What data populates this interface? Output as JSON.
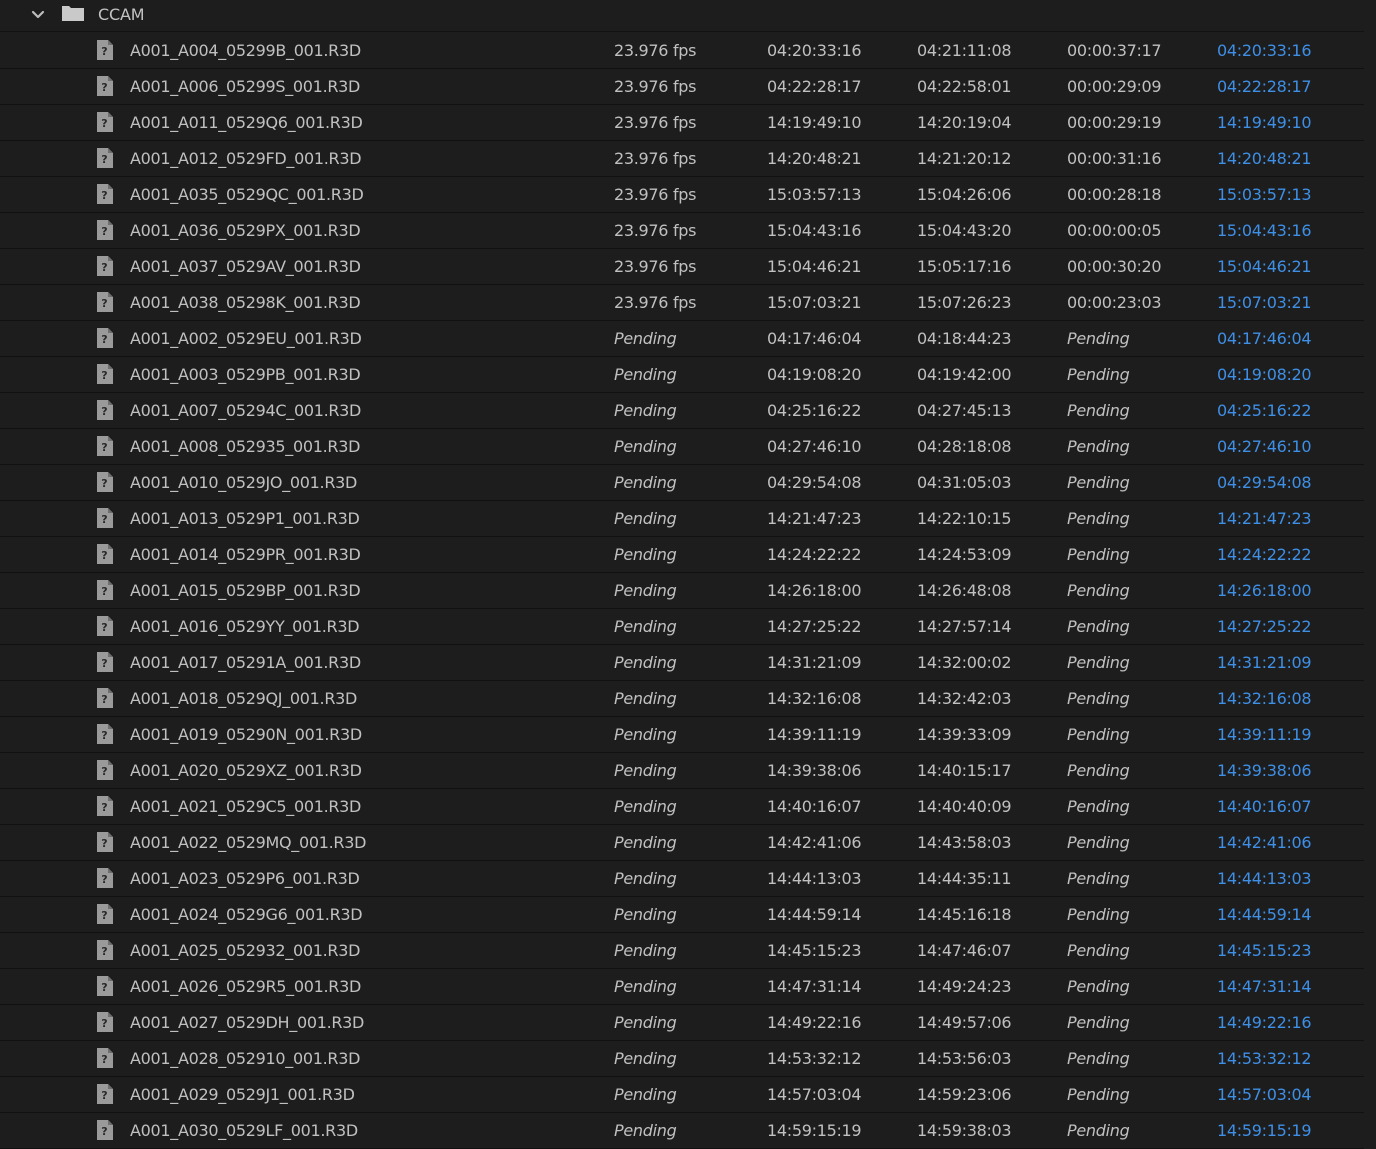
{
  "folder": {
    "name": "CCAM"
  },
  "colors": {
    "background": "#1d1d1d",
    "text": "#c0c0c0",
    "timecode_link": "#3e8fe6",
    "row_divider": "#111111"
  },
  "icons": {
    "expand": "chevron-down-icon",
    "folder": "folder-icon",
    "clip": "missing-file-icon"
  },
  "clips": [
    {
      "name": "A001_A004_05299B_001.R3D",
      "fps": "23.976 fps",
      "media_start": "04:20:33:16",
      "media_end": "04:21:11:08",
      "duration": "00:00:37:17",
      "timecode": "04:20:33:16"
    },
    {
      "name": "A001_A006_05299S_001.R3D",
      "fps": "23.976 fps",
      "media_start": "04:22:28:17",
      "media_end": "04:22:58:01",
      "duration": "00:00:29:09",
      "timecode": "04:22:28:17"
    },
    {
      "name": "A001_A011_0529Q6_001.R3D",
      "fps": "23.976 fps",
      "media_start": "14:19:49:10",
      "media_end": "14:20:19:04",
      "duration": "00:00:29:19",
      "timecode": "14:19:49:10"
    },
    {
      "name": "A001_A012_0529FD_001.R3D",
      "fps": "23.976 fps",
      "media_start": "14:20:48:21",
      "media_end": "14:21:20:12",
      "duration": "00:00:31:16",
      "timecode": "14:20:48:21"
    },
    {
      "name": "A001_A035_0529QC_001.R3D",
      "fps": "23.976 fps",
      "media_start": "15:03:57:13",
      "media_end": "15:04:26:06",
      "duration": "00:00:28:18",
      "timecode": "15:03:57:13"
    },
    {
      "name": "A001_A036_0529PX_001.R3D",
      "fps": "23.976 fps",
      "media_start": "15:04:43:16",
      "media_end": "15:04:43:20",
      "duration": "00:00:00:05",
      "timecode": "15:04:43:16"
    },
    {
      "name": "A001_A037_0529AV_001.R3D",
      "fps": "23.976 fps",
      "media_start": "15:04:46:21",
      "media_end": "15:05:17:16",
      "duration": "00:00:30:20",
      "timecode": "15:04:46:21"
    },
    {
      "name": "A001_A038_05298K_001.R3D",
      "fps": "23.976 fps",
      "media_start": "15:07:03:21",
      "media_end": "15:07:26:23",
      "duration": "00:00:23:03",
      "timecode": "15:07:03:21"
    },
    {
      "name": "A001_A002_0529EU_001.R3D",
      "fps": "Pending",
      "media_start": "04:17:46:04",
      "media_end": "04:18:44:23",
      "duration": "Pending",
      "timecode": "04:17:46:04"
    },
    {
      "name": "A001_A003_0529PB_001.R3D",
      "fps": "Pending",
      "media_start": "04:19:08:20",
      "media_end": "04:19:42:00",
      "duration": "Pending",
      "timecode": "04:19:08:20"
    },
    {
      "name": "A001_A007_05294C_001.R3D",
      "fps": "Pending",
      "media_start": "04:25:16:22",
      "media_end": "04:27:45:13",
      "duration": "Pending",
      "timecode": "04:25:16:22"
    },
    {
      "name": "A001_A008_052935_001.R3D",
      "fps": "Pending",
      "media_start": "04:27:46:10",
      "media_end": "04:28:18:08",
      "duration": "Pending",
      "timecode": "04:27:46:10"
    },
    {
      "name": "A001_A010_0529JO_001.R3D",
      "fps": "Pending",
      "media_start": "04:29:54:08",
      "media_end": "04:31:05:03",
      "duration": "Pending",
      "timecode": "04:29:54:08"
    },
    {
      "name": "A001_A013_0529P1_001.R3D",
      "fps": "Pending",
      "media_start": "14:21:47:23",
      "media_end": "14:22:10:15",
      "duration": "Pending",
      "timecode": "14:21:47:23"
    },
    {
      "name": "A001_A014_0529PR_001.R3D",
      "fps": "Pending",
      "media_start": "14:24:22:22",
      "media_end": "14:24:53:09",
      "duration": "Pending",
      "timecode": "14:24:22:22"
    },
    {
      "name": "A001_A015_0529BP_001.R3D",
      "fps": "Pending",
      "media_start": "14:26:18:00",
      "media_end": "14:26:48:08",
      "duration": "Pending",
      "timecode": "14:26:18:00"
    },
    {
      "name": "A001_A016_0529YY_001.R3D",
      "fps": "Pending",
      "media_start": "14:27:25:22",
      "media_end": "14:27:57:14",
      "duration": "Pending",
      "timecode": "14:27:25:22"
    },
    {
      "name": "A001_A017_05291A_001.R3D",
      "fps": "Pending",
      "media_start": "14:31:21:09",
      "media_end": "14:32:00:02",
      "duration": "Pending",
      "timecode": "14:31:21:09"
    },
    {
      "name": "A001_A018_0529QJ_001.R3D",
      "fps": "Pending",
      "media_start": "14:32:16:08",
      "media_end": "14:32:42:03",
      "duration": "Pending",
      "timecode": "14:32:16:08"
    },
    {
      "name": "A001_A019_05290N_001.R3D",
      "fps": "Pending",
      "media_start": "14:39:11:19",
      "media_end": "14:39:33:09",
      "duration": "Pending",
      "timecode": "14:39:11:19"
    },
    {
      "name": "A001_A020_0529XZ_001.R3D",
      "fps": "Pending",
      "media_start": "14:39:38:06",
      "media_end": "14:40:15:17",
      "duration": "Pending",
      "timecode": "14:39:38:06"
    },
    {
      "name": "A001_A021_0529C5_001.R3D",
      "fps": "Pending",
      "media_start": "14:40:16:07",
      "media_end": "14:40:40:09",
      "duration": "Pending",
      "timecode": "14:40:16:07"
    },
    {
      "name": "A001_A022_0529MQ_001.R3D",
      "fps": "Pending",
      "media_start": "14:42:41:06",
      "media_end": "14:43:58:03",
      "duration": "Pending",
      "timecode": "14:42:41:06"
    },
    {
      "name": "A001_A023_0529P6_001.R3D",
      "fps": "Pending",
      "media_start": "14:44:13:03",
      "media_end": "14:44:35:11",
      "duration": "Pending",
      "timecode": "14:44:13:03"
    },
    {
      "name": "A001_A024_0529G6_001.R3D",
      "fps": "Pending",
      "media_start": "14:44:59:14",
      "media_end": "14:45:16:18",
      "duration": "Pending",
      "timecode": "14:44:59:14"
    },
    {
      "name": "A001_A025_052932_001.R3D",
      "fps": "Pending",
      "media_start": "14:45:15:23",
      "media_end": "14:47:46:07",
      "duration": "Pending",
      "timecode": "14:45:15:23"
    },
    {
      "name": "A001_A026_0529R5_001.R3D",
      "fps": "Pending",
      "media_start": "14:47:31:14",
      "media_end": "14:49:24:23",
      "duration": "Pending",
      "timecode": "14:47:31:14"
    },
    {
      "name": "A001_A027_0529DH_001.R3D",
      "fps": "Pending",
      "media_start": "14:49:22:16",
      "media_end": "14:49:57:06",
      "duration": "Pending",
      "timecode": "14:49:22:16"
    },
    {
      "name": "A001_A028_052910_001.R3D",
      "fps": "Pending",
      "media_start": "14:53:32:12",
      "media_end": "14:53:56:03",
      "duration": "Pending",
      "timecode": "14:53:32:12"
    },
    {
      "name": "A001_A029_0529J1_001.R3D",
      "fps": "Pending",
      "media_start": "14:57:03:04",
      "media_end": "14:59:23:06",
      "duration": "Pending",
      "timecode": "14:57:03:04"
    },
    {
      "name": "A001_A030_0529LF_001.R3D",
      "fps": "Pending",
      "media_start": "14:59:15:19",
      "media_end": "14:59:38:03",
      "duration": "Pending",
      "timecode": "14:59:15:19"
    }
  ]
}
